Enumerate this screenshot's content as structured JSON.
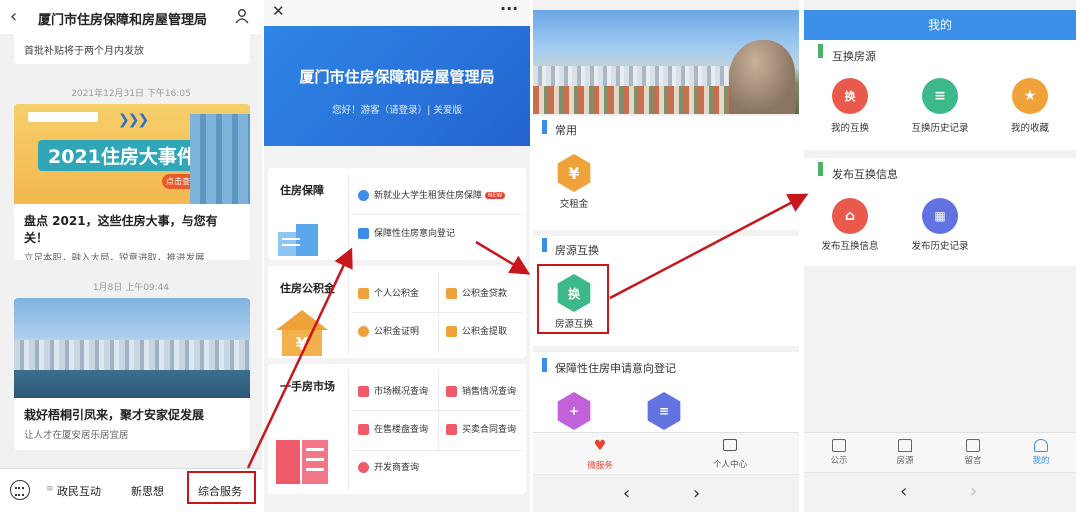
{
  "panel1": {
    "title": "厦门市住房保障和房屋管理局",
    "note": "首批补贴将于两个月内发放",
    "timestamp1": "2021年12月31日 下午16:05",
    "card1": {
      "banner_text": "2021住房大事件",
      "banner_tag": "点击查看年度盘点",
      "title": "盘点 2021，这些住房大事，与您有关！",
      "subtitle": "立足本职，融入大局，锐意进取，推进发展"
    },
    "timestamp2": "1月8日 上午09:44",
    "card2": {
      "title": "栽好梧桐引凤来，聚才安家促发展",
      "subtitle": "让人才在厦安居乐居宜居"
    },
    "menu": {
      "item1": "政民互动",
      "item2": "新思想",
      "item3": "综合服务"
    }
  },
  "panel2": {
    "hero_title": "厦门市住房保障和房屋管理局",
    "hero_subtitle": "您好！游客（请登录）| 关爱版",
    "sections": {
      "s1": {
        "title": "住房保障",
        "item1": "新就业大学生租赁住房保障",
        "item1_tag": "NEW",
        "item2": "保障性住房意向登记"
      },
      "s2": {
        "title": "住房公积金",
        "item1": "个人公积金",
        "item2": "公积金贷款",
        "item3": "公积金证明",
        "item4": "公积金提取"
      },
      "s3": {
        "title": "一手房市场",
        "item1": "市场概况查询",
        "item2": "销售情况查询",
        "item3": "在售楼盘查询",
        "item4": "买卖合同查询",
        "item5": "开发商查询"
      }
    }
  },
  "panel3": {
    "block1": {
      "title": "常用",
      "item1": "交租金"
    },
    "block2": {
      "title": "房源互换",
      "item1": "房源互换"
    },
    "block3": {
      "title": "保障性住房申请意向登记"
    },
    "tabs": {
      "tab1": "微服务",
      "tab2": "个人中心"
    }
  },
  "panel4": {
    "header": "我的",
    "block1": {
      "title": "互换房源",
      "item1": "我的互换",
      "item2": "互换历史记录",
      "item3": "我的收藏"
    },
    "block2": {
      "title": "发布互换信息",
      "item1": "发布互换信息",
      "item2": "发布历史记录"
    },
    "tabs": {
      "tab1": "公示",
      "tab2": "房源",
      "tab3": "留言",
      "tab4": "我的"
    }
  },
  "colors": {
    "highlight_red": "#c8161d",
    "primary_blue": "#3b8fe8",
    "hex_orange": "#f0a23a",
    "hex_green": "#3db88a",
    "circle_red": "#ea5a4c"
  },
  "icons": {
    "rent": "yen-icon",
    "exchange": "exchange-icon",
    "history": "list-icon",
    "favorite": "star-icon",
    "publish": "house-icon",
    "publish_history": "calendar-icon"
  }
}
